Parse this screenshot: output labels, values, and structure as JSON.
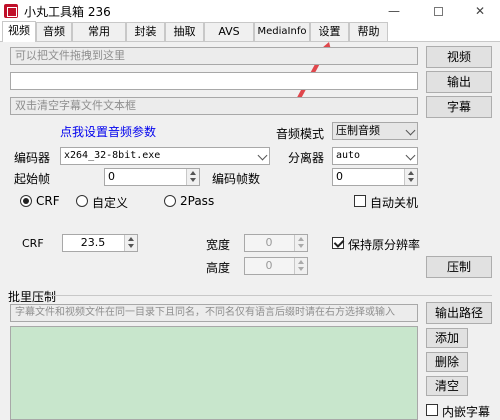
{
  "window": {
    "title": "小丸工具箱 236",
    "minimize": "—",
    "close": "✕"
  },
  "tabs": [
    "视频",
    "音频",
    "常用",
    "封装",
    "抽取",
    "AVS",
    "MediaInfo",
    "设置",
    "帮助"
  ],
  "video": {
    "video_input_placeholder": "可以把文件拖拽到这里",
    "video_button": "视频",
    "output_button": "输出",
    "subtitle_placeholder": "双击清空字幕文件文本框",
    "subtitle_button": "字幕"
  },
  "audio_params_link": "点我设置音频参数",
  "audio_mode": {
    "label": "音频模式",
    "value": "压制音频"
  },
  "encoder": {
    "label": "编码器",
    "value": "x264_32-8bit.exe"
  },
  "splitter": {
    "label": "分离器",
    "value": "auto"
  },
  "start_frame": {
    "label": "起始帧",
    "value": "0"
  },
  "encode_frames": {
    "label": "编码帧数",
    "value": "0"
  },
  "rate_mode": {
    "crf": "CRF",
    "custom": "自定义",
    "two_pass": "2Pass",
    "selected": "CRF"
  },
  "auto_shutdown": {
    "label": "自动关机",
    "checked": false
  },
  "crf": {
    "label": "CRF",
    "value": "23.5"
  },
  "width": {
    "label": "宽度",
    "value": "0"
  },
  "height": {
    "label": "高度",
    "value": "0"
  },
  "keep_resolution": {
    "label": "保持原分辨率",
    "checked": true
  },
  "encode_button": "压制",
  "batch": {
    "title": "批里压制",
    "hint": "字幕文件和视频文件在同一目录下且同名，不同名仅有语言后缀时请在右方选择或输入",
    "output_path_button": "输出路径",
    "add_button": "添加",
    "delete_button": "删除",
    "clear_button": "清空",
    "embed_subtitle": {
      "label": "内嵌字幕",
      "checked": false
    }
  },
  "colors": {
    "batch_area": "#c8e6cc",
    "link": "#0000ee",
    "annotation_arrow": "#e0474c"
  }
}
